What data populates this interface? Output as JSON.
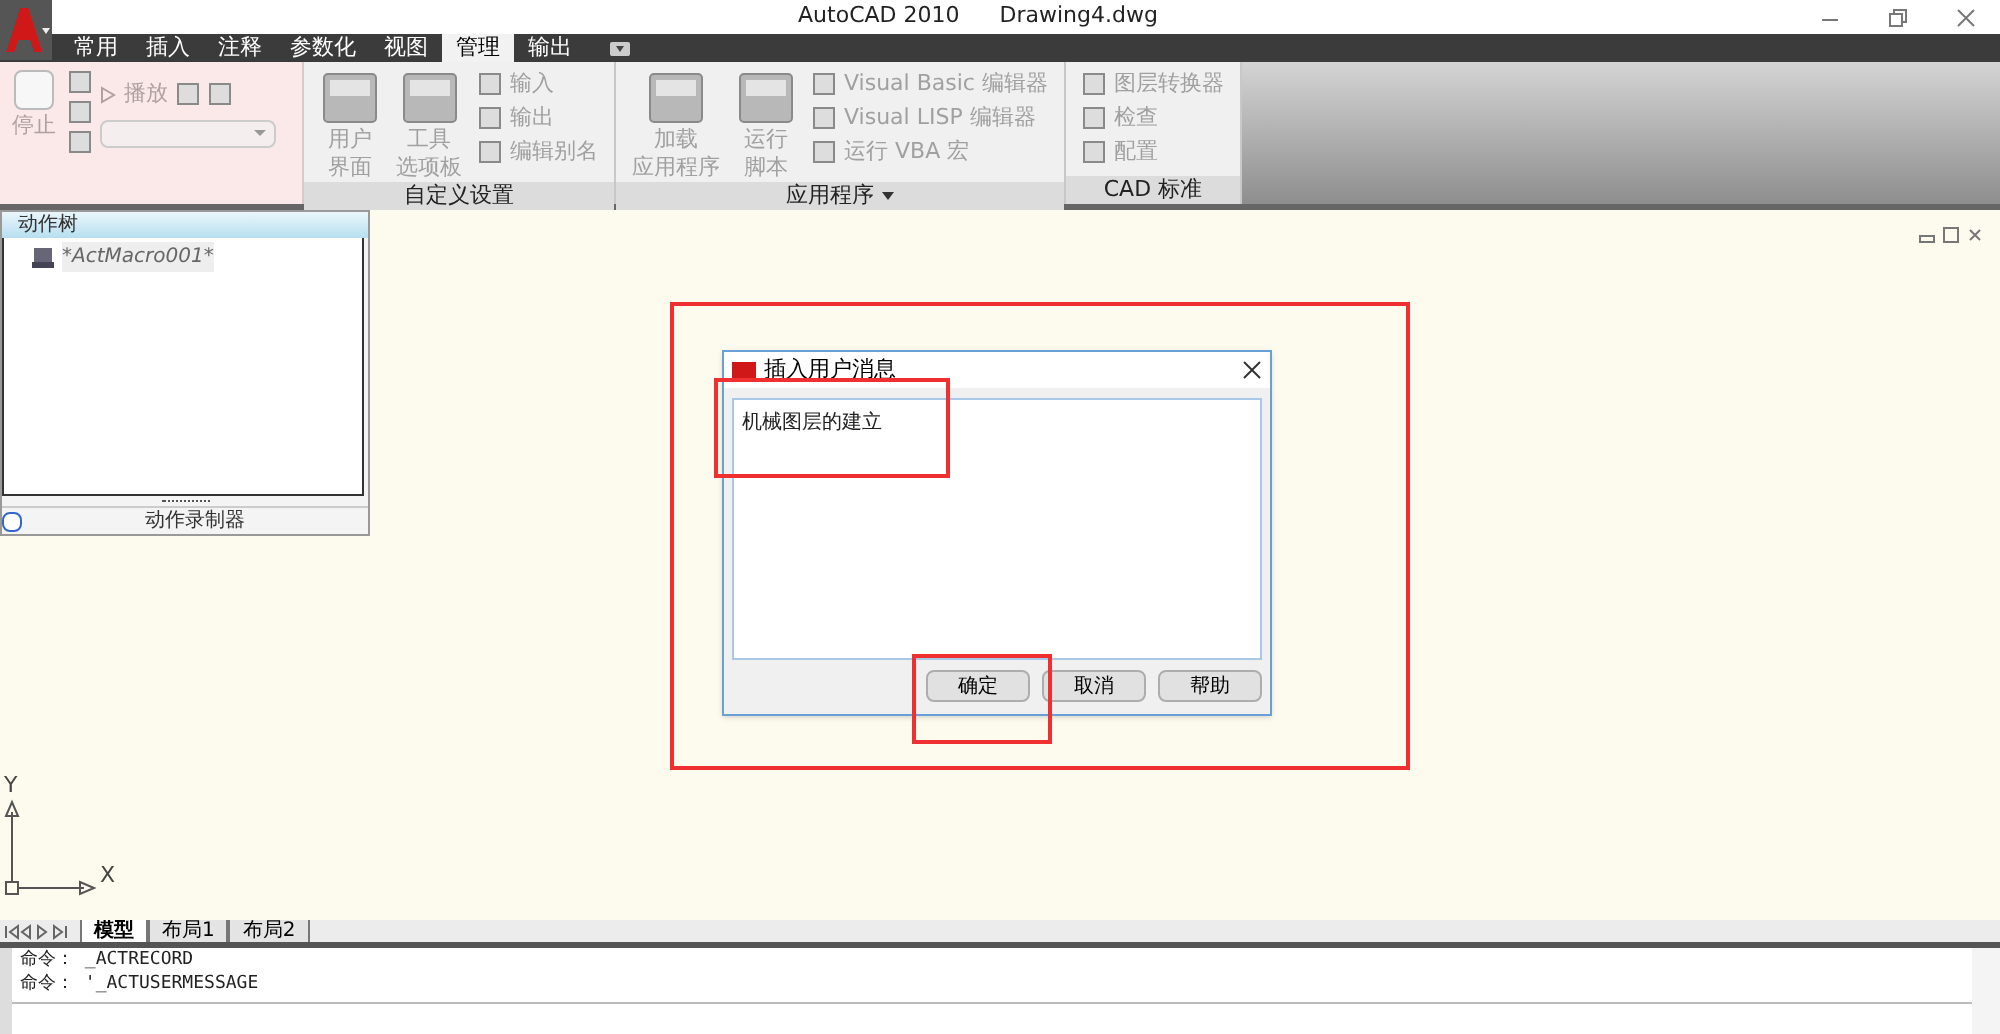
{
  "title_bar": {
    "app": "AutoCAD 2010",
    "file": "Drawing4.dwg"
  },
  "ribbon_tabs": [
    {
      "label": "常用",
      "selected": false
    },
    {
      "label": "插入",
      "selected": false
    },
    {
      "label": "注释",
      "selected": false
    },
    {
      "label": "参数化",
      "selected": false
    },
    {
      "label": "视图",
      "selected": false
    },
    {
      "label": "管理",
      "selected": true
    },
    {
      "label": "输出",
      "selected": false
    }
  ],
  "recorder_panel": {
    "stop": "停止",
    "play": "播放"
  },
  "ribbon_panels": [
    {
      "title": "自定义设置",
      "tools": [
        {
          "kind": "large",
          "lines": [
            "用户",
            "界面"
          ]
        },
        {
          "kind": "large",
          "lines": [
            "工具",
            "选项板"
          ]
        },
        {
          "kind": "small",
          "label": "输入"
        },
        {
          "kind": "small",
          "label": "输出"
        },
        {
          "kind": "small",
          "label": "编辑别名"
        }
      ]
    },
    {
      "title": "应用程序",
      "dropdown": true,
      "tools": [
        {
          "kind": "large",
          "lines": [
            "加载",
            "应用程序"
          ]
        },
        {
          "kind": "large",
          "lines": [
            "运行",
            "脚本"
          ]
        },
        {
          "kind": "small",
          "label": "Visual Basic 编辑器"
        },
        {
          "kind": "small",
          "label": "Visual LISP 编辑器"
        },
        {
          "kind": "small",
          "label": "运行 VBA 宏"
        }
      ]
    },
    {
      "title": "CAD 标准",
      "tools": [
        {
          "kind": "small",
          "label": "图层转换器"
        },
        {
          "kind": "small",
          "label": "检查"
        },
        {
          "kind": "small",
          "label": "配置"
        }
      ]
    }
  ],
  "action_tree": {
    "title": "动作树",
    "items": [
      {
        "label": "*ActMacro001*"
      }
    ],
    "footer": "动作录制器"
  },
  "dialog": {
    "title": "插入用户消息",
    "message": "机械图层的建立",
    "buttons": [
      "确定",
      "取消",
      "帮助"
    ]
  },
  "ucs": {
    "x": "X",
    "y": "Y"
  },
  "layout_tabs": [
    {
      "label": "模型",
      "selected": true
    },
    {
      "label": "布局1",
      "selected": false
    },
    {
      "label": "布局2",
      "selected": false
    }
  ],
  "command_lines": [
    "命令： _ACTRECORD",
    "命令： '_ACTUSERMESSAGE"
  ]
}
